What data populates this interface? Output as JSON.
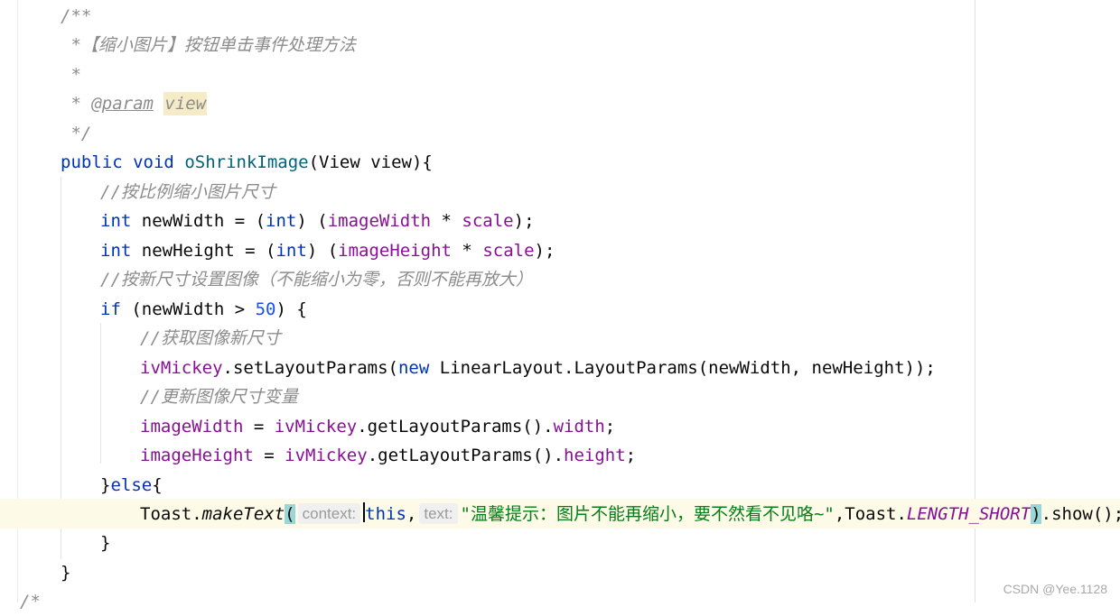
{
  "javadoc": {
    "open": "/**",
    "summary_star": " *",
    "summary": "【缩小图片】按钮单击事件处理方法",
    "blank_star": " *",
    "param_star": " * ",
    "param_tag": "@param",
    "param_name": "view",
    "close": " */"
  },
  "signature": {
    "kw_public": "public",
    "kw_void": "void",
    "method_name": "oShrinkImage",
    "params": "(View view){"
  },
  "lines": {
    "c1": "//按比例缩小图片尺寸",
    "w_kw": "int",
    "w_mid": " newWidth = (",
    "w_cast": "int",
    "w_after": ") (",
    "w_field": "imageWidth",
    "w_op": " * ",
    "w_scale": "scale",
    "w_end": ");",
    "h_kw": "int",
    "h_mid": " newHeight = (",
    "h_cast": "int",
    "h_after": ") (",
    "h_field": "imageHeight",
    "h_op": " * ",
    "h_scale": "scale",
    "h_end": ");",
    "c2": "//按新尺寸设置图像（不能缩小为零，否则不能再放大）",
    "if_kw": "if",
    "if_mid": " (newWidth > ",
    "if_num": "50",
    "if_end": ") {",
    "c3": "//获取图像新尺寸",
    "set_field": "ivMickey",
    "set_mid": ".setLayoutParams(",
    "set_new": "new",
    "set_end": " LinearLayout.LayoutParams(newWidth, newHeight));",
    "c4": "//更新图像尺寸变量",
    "iw_field": "imageWidth",
    "iw_mid": " = ",
    "iw_obj": "ivMickey",
    "iw_call": ".getLayoutParams().",
    "iw_prop": "width",
    "iw_end": ";",
    "ih_field": "imageHeight",
    "ih_mid": " = ",
    "ih_obj": "ivMickey",
    "ih_call": ".getLayoutParams().",
    "ih_prop": "height",
    "ih_end": ";",
    "else_a": "}",
    "else_kw": "else",
    "else_b": "{",
    "toast_obj": "Toast.",
    "toast_method": "makeText",
    "toast_open": "(",
    "hint_context": "context:",
    "toast_this": "this",
    "toast_comma1": ",",
    "hint_text": "text:",
    "toast_str": "\"温馨提示：图片不能再缩小，要不然看不见咯~\"",
    "toast_comma2": ",Toast.",
    "toast_const": "LENGTH_SHORT",
    "toast_close": ")",
    "toast_end": ".show();",
    "close_inner": "}",
    "close_method": "}",
    "partial": "/*"
  },
  "watermark": "CSDN @Yee.1128"
}
